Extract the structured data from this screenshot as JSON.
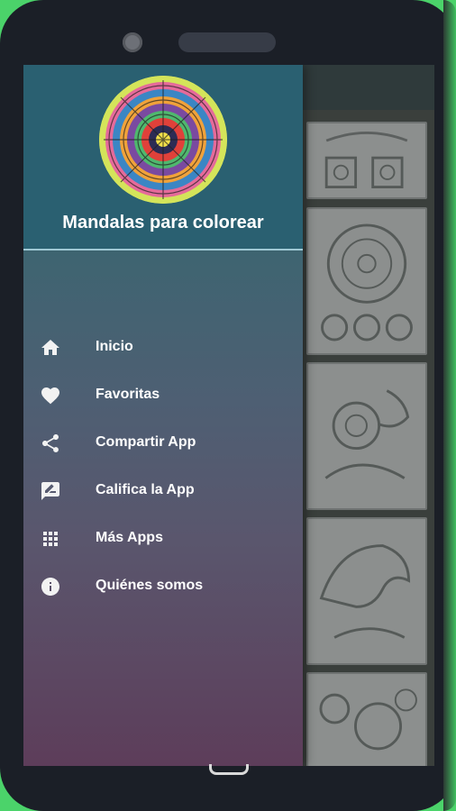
{
  "drawer": {
    "app_name": "Mandalas para colorear",
    "items": [
      {
        "label": "Inicio",
        "icon": "home-icon"
      },
      {
        "label": "Favoritas",
        "icon": "heart-icon"
      },
      {
        "label": "Compartir App",
        "icon": "share-icon"
      },
      {
        "label": "Califica la App",
        "icon": "rate-review-icon"
      },
      {
        "label": "Más Apps",
        "icon": "apps-grid-icon"
      },
      {
        "label": "Quiénes somos",
        "icon": "info-icon"
      }
    ]
  },
  "colors": {
    "phone_frame": "#1b1f27",
    "background": "#4bd36a",
    "drawer_header": "#2a6071",
    "drawer_gradient_top": "#2f5b66",
    "drawer_gradient_bottom": "#5d3d5a",
    "text": "#ffffff"
  }
}
